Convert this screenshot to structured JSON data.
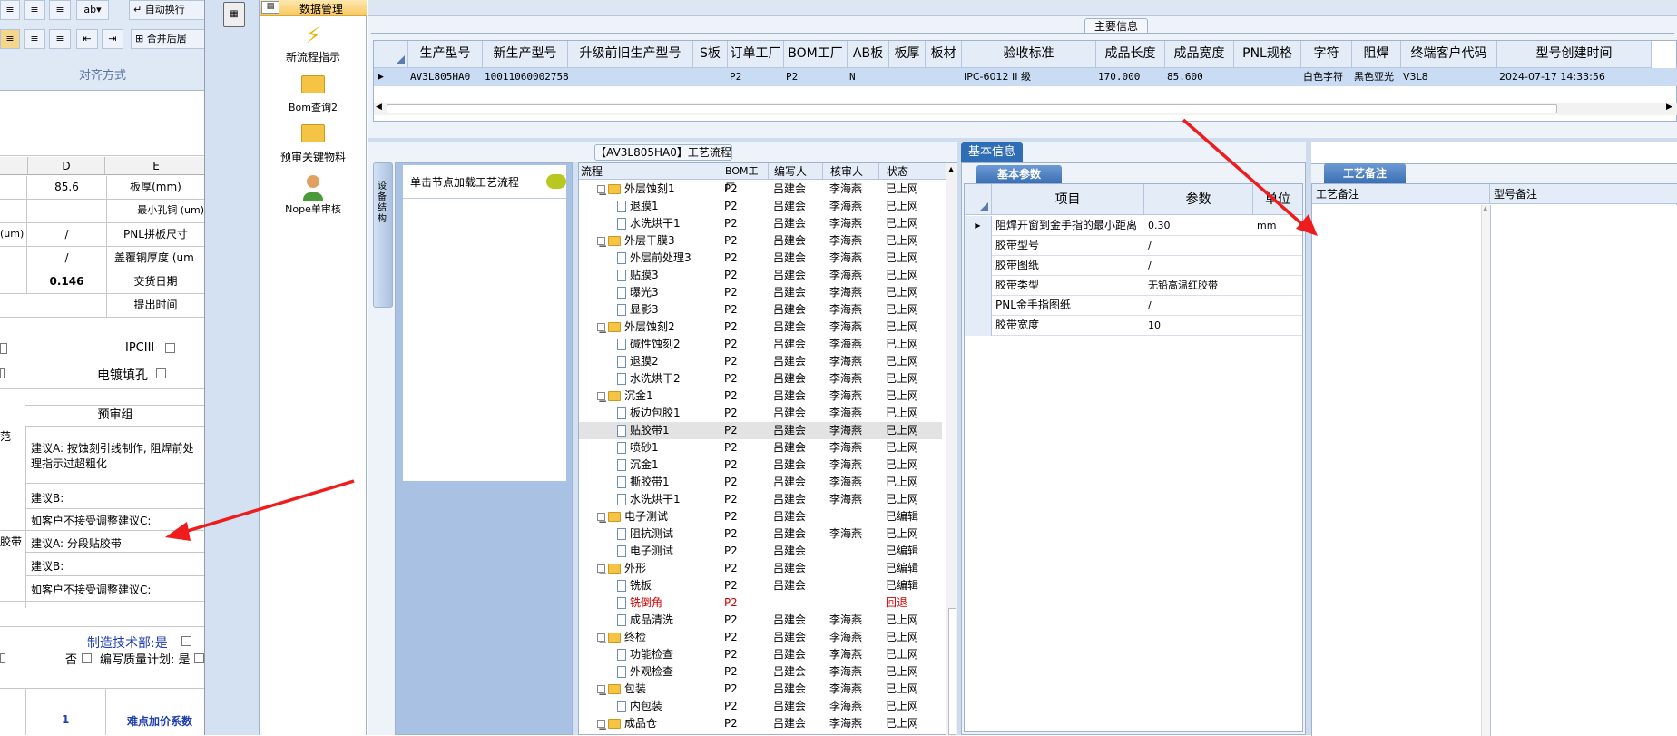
{
  "excel": {
    "ribbon": {
      "wrap": "自动换行",
      "merge": "合并后居",
      "align_group": "对齐方式"
    },
    "cols": [
      "D",
      "E"
    ],
    "rows": [
      {
        "d": "85.6",
        "e": "板厚(mm)"
      },
      {
        "d": "",
        "e": "最小孔铜 (um)"
      },
      {
        "c": "(um)",
        "d": "/",
        "e": "PNL拼板尺寸"
      },
      {
        "d": "/",
        "e": "盖覆铜厚度 (um"
      },
      {
        "d": "0.146",
        "e": "交货日期"
      },
      {
        "d": "",
        "e": "提出时间"
      }
    ],
    "ipc": "IPCIII",
    "plating": "电镀填孔",
    "review_group": "预审组",
    "spec": "范",
    "suggA1": "建议A: 按蚀刻引线制作, 阻焊前处",
    "suggA1b": "理指示过超粗化",
    "suggB1": "建议B:",
    "suggC1": "如客户不接受调整建议C:",
    "tape": "胶带",
    "suggA2": "建议A: 分段贴胶带",
    "suggB2": "建议B:",
    "suggC2": "如客户不接受调整建议C:",
    "mfg": "制造技术部:是",
    "no": "否",
    "quality": "编写质量计划: 是",
    "num": "1",
    "difficulty": "难点加价系数"
  },
  "nav": {
    "top": "数据管理",
    "items": [
      {
        "label": "新流程指示",
        "icon": "lightning-icon"
      },
      {
        "label": "Bom查询2",
        "icon": "folder-icon"
      },
      {
        "label": "预审关键物料",
        "icon": "folder-icon"
      },
      {
        "label": "Nope单审核",
        "icon": "user-icon"
      }
    ]
  },
  "main_info": {
    "title": "主要信息",
    "headers": [
      "生产型号",
      "新生产型号",
      "升级前旧生产型号",
      "S板",
      "订单工厂",
      "BOM工厂",
      "AB板",
      "板厚",
      "板材",
      "验收标准",
      "成品长度",
      "成品宽度",
      "PNL规格",
      "字符",
      "阻焊",
      "终端客户代码",
      "型号创建时间"
    ],
    "row": [
      "AV3L805HA0",
      "10011060002758",
      "",
      "",
      "P2",
      "P2",
      "N",
      "",
      "",
      "IPC-6012 II 级",
      "170.000",
      "85.600",
      "",
      "白色字符",
      "黑色亚光",
      "V3L8",
      "2024-07-17 14:33:56"
    ]
  },
  "process": {
    "title": "【AV3L805HA0】工艺流程",
    "side_tab": "设备结构",
    "click_hint": "单击节点加载工艺流程",
    "headers": [
      "流程",
      "BOM工厂",
      "编写人",
      "核审人",
      "状态"
    ],
    "rows": [
      {
        "n": "外层蚀刻1",
        "lvl": 0,
        "f": "P2",
        "w": "吕建会",
        "r": "李海燕",
        "s": "已上网"
      },
      {
        "n": "退膜1",
        "lvl": 1,
        "f": "P2",
        "w": "吕建会",
        "r": "李海燕",
        "s": "已上网"
      },
      {
        "n": "水洗烘干1",
        "lvl": 1,
        "f": "P2",
        "w": "吕建会",
        "r": "李海燕",
        "s": "已上网"
      },
      {
        "n": "外层干膜3",
        "lvl": 0,
        "f": "P2",
        "w": "吕建会",
        "r": "李海燕",
        "s": "已上网"
      },
      {
        "n": "外层前处理3",
        "lvl": 1,
        "f": "P2",
        "w": "吕建会",
        "r": "李海燕",
        "s": "已上网"
      },
      {
        "n": "贴膜3",
        "lvl": 1,
        "f": "P2",
        "w": "吕建会",
        "r": "李海燕",
        "s": "已上网"
      },
      {
        "n": "曝光3",
        "lvl": 1,
        "f": "P2",
        "w": "吕建会",
        "r": "李海燕",
        "s": "已上网"
      },
      {
        "n": "显影3",
        "lvl": 1,
        "f": "P2",
        "w": "吕建会",
        "r": "李海燕",
        "s": "已上网"
      },
      {
        "n": "外层蚀刻2",
        "lvl": 0,
        "f": "P2",
        "w": "吕建会",
        "r": "李海燕",
        "s": "已上网"
      },
      {
        "n": "碱性蚀刻2",
        "lvl": 1,
        "f": "P2",
        "w": "吕建会",
        "r": "李海燕",
        "s": "已上网"
      },
      {
        "n": "退膜2",
        "lvl": 1,
        "f": "P2",
        "w": "吕建会",
        "r": "李海燕",
        "s": "已上网"
      },
      {
        "n": "水洗烘干2",
        "lvl": 1,
        "f": "P2",
        "w": "吕建会",
        "r": "李海燕",
        "s": "已上网"
      },
      {
        "n": "沉金1",
        "lvl": 0,
        "f": "P2",
        "w": "吕建会",
        "r": "李海燕",
        "s": "已上网"
      },
      {
        "n": "板边包胶1",
        "lvl": 1,
        "f": "P2",
        "w": "吕建会",
        "r": "李海燕",
        "s": "已上网"
      },
      {
        "n": "贴胶带1",
        "lvl": 1,
        "f": "P2",
        "w": "吕建会",
        "r": "李海燕",
        "s": "已上网",
        "sel": true
      },
      {
        "n": "喷砂1",
        "lvl": 1,
        "f": "P2",
        "w": "吕建会",
        "r": "李海燕",
        "s": "已上网"
      },
      {
        "n": "沉金1",
        "lvl": 1,
        "f": "P2",
        "w": "吕建会",
        "r": "李海燕",
        "s": "已上网"
      },
      {
        "n": "撕胶带1",
        "lvl": 1,
        "f": "P2",
        "w": "吕建会",
        "r": "李海燕",
        "s": "已上网"
      },
      {
        "n": "水洗烘干1",
        "lvl": 1,
        "f": "P2",
        "w": "吕建会",
        "r": "李海燕",
        "s": "已上网"
      },
      {
        "n": "电子测试",
        "lvl": 0,
        "f": "P2",
        "w": "吕建会",
        "r": "",
        "s": "已编辑"
      },
      {
        "n": "阻抗测试",
        "lvl": 1,
        "f": "P2",
        "w": "吕建会",
        "r": "李海燕",
        "s": "已上网"
      },
      {
        "n": "电子测试",
        "lvl": 1,
        "f": "P2",
        "w": "吕建会",
        "r": "",
        "s": "已编辑"
      },
      {
        "n": "外形",
        "lvl": 0,
        "f": "P2",
        "w": "吕建会",
        "r": "",
        "s": "已编辑"
      },
      {
        "n": "铣板",
        "lvl": 1,
        "f": "P2",
        "w": "吕建会",
        "r": "",
        "s": "已编辑"
      },
      {
        "n": "铣倒角",
        "lvl": 1,
        "f": "P2",
        "w": "",
        "r": "",
        "s": "回退",
        "red": true
      },
      {
        "n": "成品清洗",
        "lvl": 1,
        "f": "P2",
        "w": "吕建会",
        "r": "李海燕",
        "s": "已上网"
      },
      {
        "n": "终检",
        "lvl": 0,
        "f": "P2",
        "w": "吕建会",
        "r": "李海燕",
        "s": "已上网"
      },
      {
        "n": "功能检查",
        "lvl": 1,
        "f": "P2",
        "w": "吕建会",
        "r": "李海燕",
        "s": "已上网"
      },
      {
        "n": "外观检查",
        "lvl": 1,
        "f": "P2",
        "w": "吕建会",
        "r": "李海燕",
        "s": "已上网"
      },
      {
        "n": "包装",
        "lvl": 0,
        "f": "P2",
        "w": "吕建会",
        "r": "李海燕",
        "s": "已上网"
      },
      {
        "n": "内包装",
        "lvl": 1,
        "f": "P2",
        "w": "吕建会",
        "r": "李海燕",
        "s": "已上网"
      },
      {
        "n": "成品仓",
        "lvl": 0,
        "f": "P2",
        "w": "吕建会",
        "r": "李海燕",
        "s": "已上网"
      }
    ]
  },
  "basic": {
    "tab": "基本信息",
    "subtab": "基本参数",
    "headers": [
      "项目",
      "参数",
      "单位"
    ],
    "rows": [
      {
        "item": "阻焊开窗到金手指的最小距离",
        "param": "0.30",
        "unit": "mm"
      },
      {
        "item": "胶带型号",
        "param": "/",
        "unit": ""
      },
      {
        "item": "胶带图纸",
        "param": "/",
        "unit": ""
      },
      {
        "item": "胶带类型",
        "param": "无铅高温红胶带",
        "unit": ""
      },
      {
        "item": "PNL金手指图纸",
        "param": "/",
        "unit": ""
      },
      {
        "item": "胶带宽度",
        "param": "10",
        "unit": ""
      }
    ]
  },
  "remarks": {
    "tab": "工艺备注",
    "col1": "工艺备注",
    "col2": "型号备注"
  },
  "colors": {
    "accent": "#2f6db5",
    "arrow": "#ee1c1c",
    "status_red": "#d40000"
  }
}
